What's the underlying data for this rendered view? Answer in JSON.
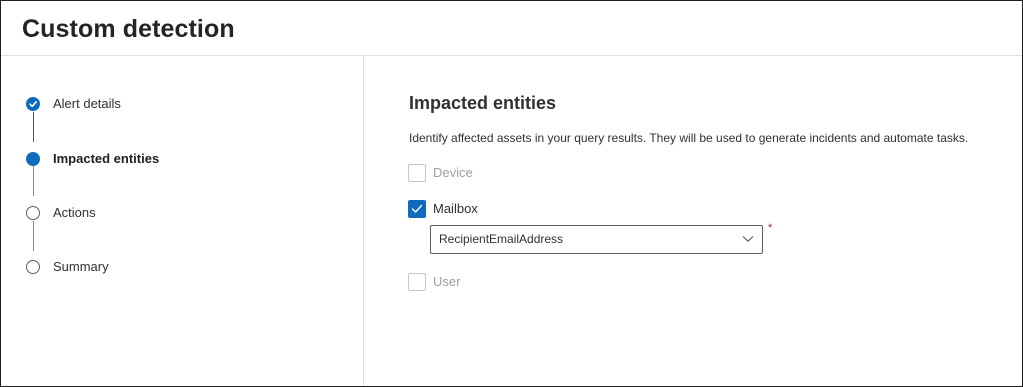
{
  "header": {
    "title": "Custom detection"
  },
  "steps": [
    {
      "label": "Alert details",
      "state": "completed"
    },
    {
      "label": "Impacted entities",
      "state": "current"
    },
    {
      "label": "Actions",
      "state": "upcoming"
    },
    {
      "label": "Summary",
      "state": "upcoming"
    }
  ],
  "main": {
    "title": "Impacted entities",
    "description": "Identify affected assets in your query results. They will be used to generate incidents and automate tasks.",
    "entities": {
      "device": {
        "label": "Device",
        "checked": false,
        "disabled": true
      },
      "mailbox": {
        "label": "Mailbox",
        "checked": true,
        "disabled": false,
        "selected_field": "RecipientEmailAddress",
        "required_marker": "*"
      },
      "user": {
        "label": "User",
        "checked": false,
        "disabled": true
      }
    }
  },
  "colors": {
    "accent": "#0f6cbd",
    "required": "#a4262c"
  },
  "icons": {
    "check": "checkmark-icon",
    "dropdown": "chevron-down-icon"
  }
}
